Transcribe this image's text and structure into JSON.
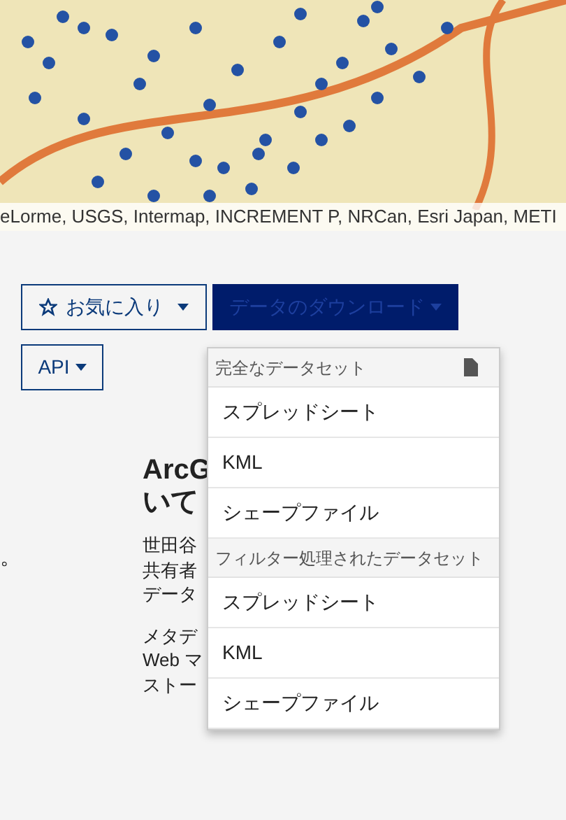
{
  "map": {
    "attribution": "eLorme, USGS, Intermap, INCREMENT P, NRCan, Esri Japan, METI"
  },
  "favorite_button": {
    "label": "お気に入り"
  },
  "download_button": {
    "label": "データのダウンロード",
    "expanded": true
  },
  "api_button": {
    "label": "API"
  },
  "download_menu": [
    {
      "header": "完全なデータセット",
      "file_icon": true,
      "items": [
        "スプレッドシート",
        "KML",
        "シェープファイル"
      ]
    },
    {
      "header": "フィルター処理されたデータセット",
      "file_icon": false,
      "items": [
        "スプレッドシート",
        "KML",
        "シェープファイル"
      ]
    }
  ],
  "left_fragment": "。",
  "heading_lines": [
    "ArcG",
    "いて"
  ],
  "paragraphs": [
    [
      "世田谷",
      "共有者",
      "データ"
    ],
    [
      "メタデ",
      "Web マ",
      "ストー"
    ]
  ]
}
